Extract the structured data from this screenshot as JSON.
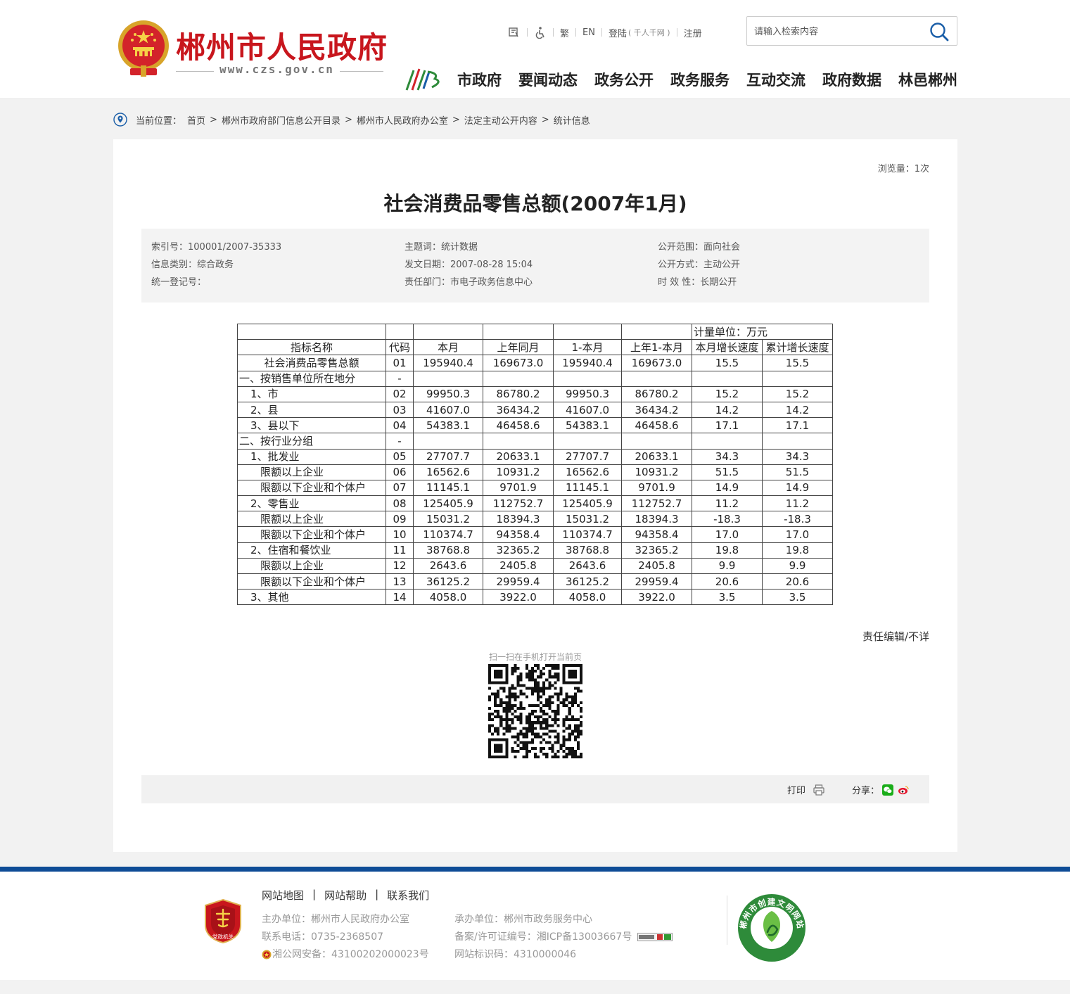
{
  "header": {
    "site_title": "郴州市人民政府",
    "site_url": "www.czs.gov.cn",
    "toolbar": {
      "traditional": "繁",
      "english": "EN",
      "login": "登陆",
      "login_sub": "( 千人千网 )",
      "register": "注册"
    },
    "search": {
      "placeholder": "请输入检索内容"
    },
    "nav": [
      "市政府",
      "要闻动态",
      "政务公开",
      "政务服务",
      "互动交流",
      "政府数据",
      "林邑郴州"
    ]
  },
  "breadcrumb": {
    "label": "当前位置：",
    "items": [
      "首页",
      "郴州市政府部门信息公开目录",
      "郴州市人民政府办公室",
      "法定主动公开内容",
      "统计信息"
    ]
  },
  "article": {
    "views": "浏览量：1次",
    "title": "社会消费品零售总额(2007年1月)",
    "meta": {
      "index_no": "索引号：100001/2007-35333",
      "category": "信息类别：综合政务",
      "reg_no": "统一登记号：",
      "keywords": "主题词：统计数据",
      "date": "发文日期：2007-08-28 15:04",
      "department": "责任部门：市电子政务信息中心",
      "scope": "公开范围：面向社会",
      "mode": "公开方式：主动公开",
      "validity": "时 效 性：长期公开"
    },
    "editor": "责任编辑/不详",
    "qr_caption": "扫一扫在手机打开当前页",
    "print": "打印",
    "share": "分享："
  },
  "table": {
    "unit": "计量单位：万元",
    "headers": [
      "指标名称",
      "代码",
      "本月",
      "上年同月",
      "1-本月",
      "上年1-本月",
      "本月增长速度",
      "累计增长速度"
    ],
    "rows": [
      [
        "社会消费品零售总额",
        "01",
        "195940.4",
        "169673.0",
        "195940.4",
        "169673.0",
        "15.5",
        "15.5"
      ],
      [
        "一、按销售单位所在地分",
        "-",
        "",
        "",
        "",
        "",
        "",
        ""
      ],
      [
        "1、市",
        "02",
        "99950.3",
        "86780.2",
        "99950.3",
        "86780.2",
        "15.2",
        "15.2"
      ],
      [
        "2、县",
        "03",
        "41607.0",
        "36434.2",
        "41607.0",
        "36434.2",
        "14.2",
        "14.2"
      ],
      [
        "3、县以下",
        "04",
        "54383.1",
        "46458.6",
        "54383.1",
        "46458.6",
        "17.1",
        "17.1"
      ],
      [
        "二、按行业分组",
        "-",
        "",
        "",
        "",
        "",
        "",
        ""
      ],
      [
        "1、批发业",
        "05",
        "27707.7",
        "20633.1",
        "27707.7",
        "20633.1",
        "34.3",
        "34.3"
      ],
      [
        "限额以上企业",
        "06",
        "16562.6",
        "10931.2",
        "16562.6",
        "10931.2",
        "51.5",
        "51.5"
      ],
      [
        "限额以下企业和个体户",
        "07",
        "11145.1",
        "9701.9",
        "11145.1",
        "9701.9",
        "14.9",
        "14.9"
      ],
      [
        "2、零售业",
        "08",
        "125405.9",
        "112752.7",
        "125405.9",
        "112752.7",
        "11.2",
        "11.2"
      ],
      [
        "限额以上企业",
        "09",
        "15031.2",
        "18394.3",
        "15031.2",
        "18394.3",
        "-18.3",
        "-18.3"
      ],
      [
        "限额以下企业和个体户",
        "10",
        "110374.7",
        "94358.4",
        "110374.7",
        "94358.4",
        "17.0",
        "17.0"
      ],
      [
        "2、住宿和餐饮业",
        "11",
        "38768.8",
        "32365.2",
        "38768.8",
        "32365.2",
        "19.8",
        "19.8"
      ],
      [
        "限额以上企业",
        "12",
        "2643.6",
        "2405.8",
        "2643.6",
        "2405.8",
        "9.9",
        "9.9"
      ],
      [
        "限额以下企业和个体户",
        "13",
        "36125.2",
        "29959.4",
        "36125.2",
        "29959.4",
        "20.6",
        "20.6"
      ],
      [
        "3、其他",
        "14",
        "4058.0",
        "3922.0",
        "4058.0",
        "3922.0",
        "3.5",
        "3.5"
      ]
    ]
  },
  "footer": {
    "links": [
      "网站地图",
      "网站帮助",
      "联系我们"
    ],
    "host": "主办单位：郴州市人民政府办公室",
    "phone": "联系电话：0735-2368507",
    "police": "湘公网安备：43100202000023号",
    "operator": "承办单位：郴州市政务服务中心",
    "icp": "备案/许可证编号：湘ICP备13003667号",
    "site_id": "网站标识码：4310000046",
    "party_badge_text": "党政机关",
    "civ_badge_text": "郴州市创建文明网站"
  },
  "colors": {
    "brand_red": "#c8161d",
    "footer_blue": "#0e4c96",
    "search_blue": "#1a5ea8"
  }
}
